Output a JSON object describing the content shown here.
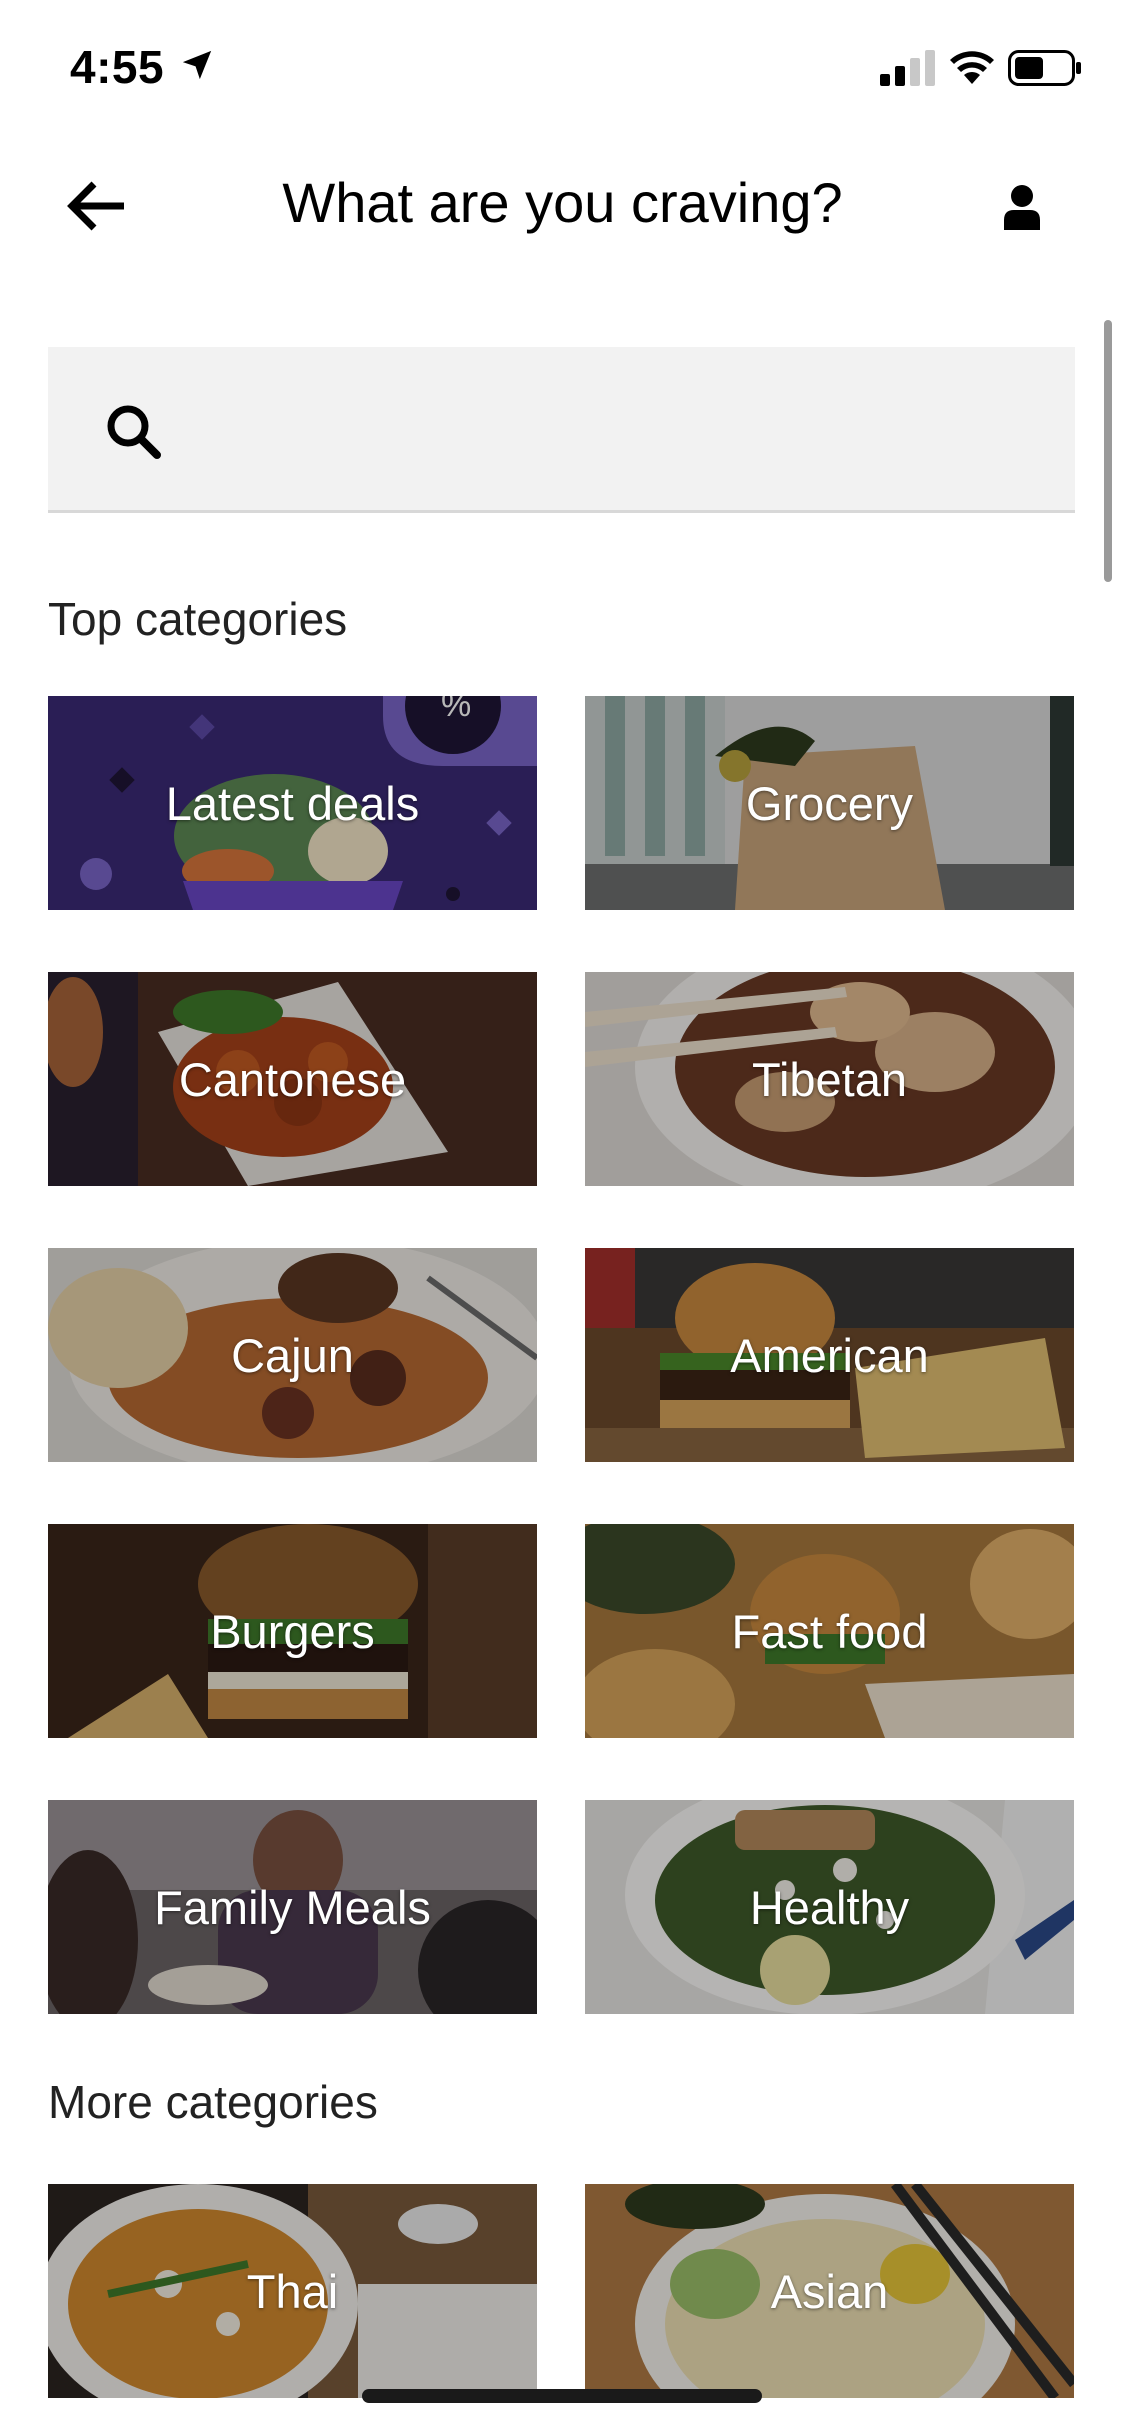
{
  "status_bar": {
    "time": "4:55"
  },
  "header": {
    "title": "What are you craving?"
  },
  "search": {
    "placeholder": ""
  },
  "sections": {
    "top": {
      "title": "Top categories"
    },
    "more": {
      "title": "More categories"
    }
  },
  "top_categories": [
    {
      "label": "Latest deals",
      "accent": "#3b2a76"
    },
    {
      "label": "Grocery",
      "accent": "#c9a57c"
    },
    {
      "label": "Cantonese",
      "accent": "#8a3d1d"
    },
    {
      "label": "Tibetan",
      "accent": "#7b5440"
    },
    {
      "label": "Cajun",
      "accent": "#8b5a35"
    },
    {
      "label": "American",
      "accent": "#6d4a2c"
    },
    {
      "label": "Burgers",
      "accent": "#4b3324"
    },
    {
      "label": "Fast food",
      "accent": "#a8793e"
    },
    {
      "label": "Family Meals",
      "accent": "#5a4a4a"
    },
    {
      "label": "Healthy",
      "accent": "#4c5a36"
    }
  ],
  "more_categories": [
    {
      "label": "Thai",
      "accent": "#c77b2a"
    },
    {
      "label": "Asian",
      "accent": "#a67c52"
    }
  ],
  "colors": {
    "primary_text": "#000000",
    "search_bg": "#f2f2f2"
  }
}
